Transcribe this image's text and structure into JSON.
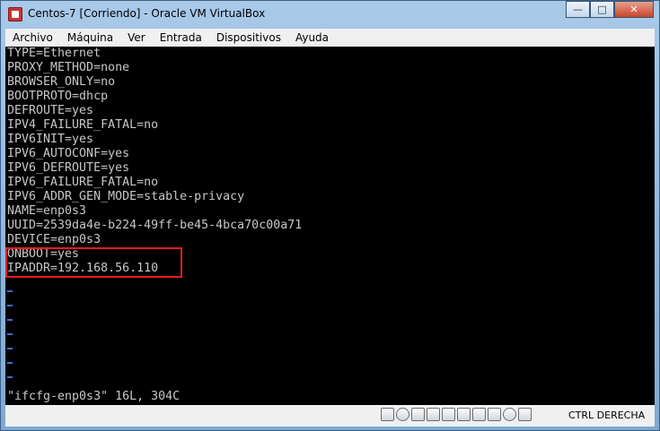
{
  "window": {
    "title": "Centos-7 [Corriendo] - Oracle VM VirtualBox"
  },
  "menu": [
    "Archivo",
    "Máquina",
    "Ver",
    "Entrada",
    "Dispositivos",
    "Ayuda"
  ],
  "terminal": {
    "lines": [
      "TYPE=Ethernet",
      "PROXY_METHOD=none",
      "BROWSER_ONLY=no",
      "BOOTPROTO=dhcp",
      "DEFROUTE=yes",
      "IPV4_FAILURE_FATAL=no",
      "IPV6INIT=yes",
      "IPV6_AUTOCONF=yes",
      "IPV6_DEFROUTE=yes",
      "IPV6_FAILURE_FATAL=no",
      "IPV6_ADDR_GEN_MODE=stable-privacy",
      "NAME=enp0s3",
      "UUID=2539da4e-b224-49ff-be45-4bca70c00a71",
      "DEVICE=enp0s3",
      "ONBOOT=yes",
      "IPADDR=192.168.56.110"
    ],
    "status_line": "\"ifcfg-enp0s3\" 16L, 304C",
    "highlight_color": "#e41e1e"
  },
  "statusbar": {
    "icons": [
      "storage-icon",
      "optical-drive-icon",
      "audio-icon",
      "network-icon",
      "usb-icon",
      "shared-folder-icon",
      "display-icon",
      "recording-icon",
      "mouse-integration-icon",
      "host-key-arrow-icon"
    ],
    "host_key": "CTRL DERECHA"
  }
}
